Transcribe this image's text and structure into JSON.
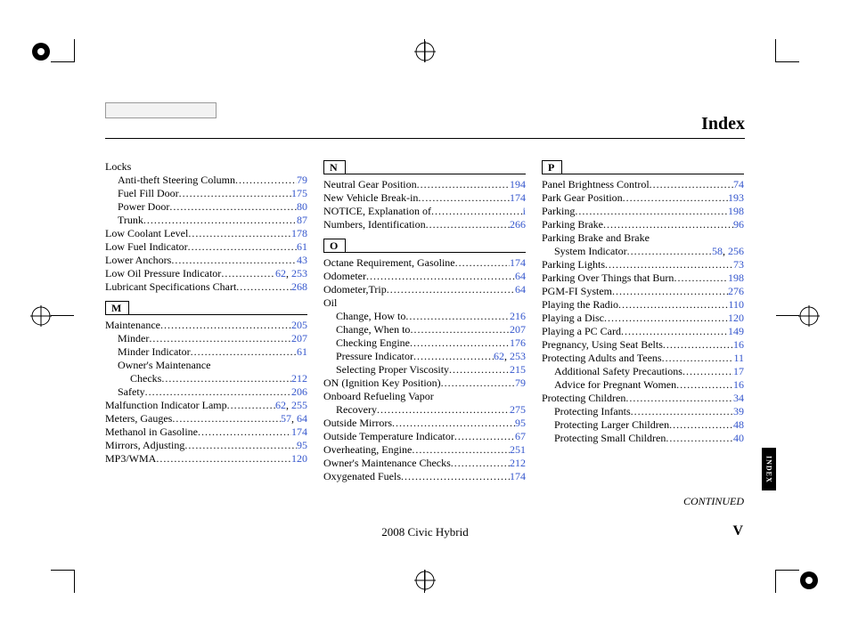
{
  "header": {
    "title": "Index"
  },
  "side_tab": "INDEX",
  "continued_text": "CONTINUED",
  "footer": {
    "model": "2008  Civic  Hybrid",
    "page": "V"
  },
  "sections": {
    "L_pre": [
      {
        "label": "Locks",
        "pages": [],
        "indent": 0,
        "nopage": true
      },
      {
        "label": "Anti-theft Steering Column",
        "pages": [
          "79"
        ],
        "indent": 1
      },
      {
        "label": "Fuel Fill Door",
        "pages": [
          "175"
        ],
        "indent": 1
      },
      {
        "label": "Power Door",
        "pages": [
          "80"
        ],
        "indent": 1
      },
      {
        "label": "Trunk",
        "pages": [
          "87"
        ],
        "indent": 1
      },
      {
        "label": "Low Coolant Level",
        "pages": [
          "178"
        ],
        "indent": 0
      },
      {
        "label": "Low Fuel Indicator",
        "pages": [
          "61"
        ],
        "indent": 0
      },
      {
        "label": "Lower Anchors",
        "pages": [
          "43"
        ],
        "indent": 0
      },
      {
        "label": "Low Oil Pressure Indicator",
        "pages": [
          "62",
          "253"
        ],
        "indent": 0
      },
      {
        "label": "Lubricant Specifications Chart",
        "pages": [
          "268"
        ],
        "indent": 0
      }
    ],
    "M": [
      {
        "label": "Maintenance",
        "pages": [
          "205"
        ],
        "indent": 0
      },
      {
        "label": "Minder",
        "pages": [
          "207"
        ],
        "indent": 1
      },
      {
        "label": "Minder Indicator",
        "pages": [
          "61"
        ],
        "indent": 1
      },
      {
        "label": "Owner's Maintenance",
        "pages": [],
        "indent": 1,
        "nopage": true
      },
      {
        "label": "Checks",
        "pages": [
          "212"
        ],
        "indent": 2
      },
      {
        "label": "Safety",
        "pages": [
          "206"
        ],
        "indent": 1
      },
      {
        "label": "Malfunction Indicator Lamp",
        "pages": [
          "62",
          "255"
        ],
        "indent": 0
      },
      {
        "label": "Meters, Gauges",
        "pages": [
          "57",
          "64"
        ],
        "indent": 0
      },
      {
        "label": "Methanol in Gasoline",
        "pages": [
          "174"
        ],
        "indent": 0
      },
      {
        "label": "Mirrors, Adjusting",
        "pages": [
          "95"
        ],
        "indent": 0
      },
      {
        "label": "MP3/WMA",
        "pages": [
          "120"
        ],
        "indent": 0
      }
    ],
    "N": [
      {
        "label": "Neutral Gear Position",
        "pages": [
          "194"
        ],
        "indent": 0
      },
      {
        "label": "New Vehicle Break-in",
        "pages": [
          "174"
        ],
        "indent": 0
      },
      {
        "label": "NOTICE, Explanation of",
        "pages": [
          "i"
        ],
        "indent": 0
      },
      {
        "label": "Numbers, Identification",
        "pages": [
          "266"
        ],
        "indent": 0
      }
    ],
    "O": [
      {
        "label": "Octane Requirement, Gasoline",
        "pages": [
          "174"
        ],
        "indent": 0
      },
      {
        "label": "Odometer",
        "pages": [
          "64"
        ],
        "indent": 0
      },
      {
        "label": "Odometer,Trip",
        "pages": [
          "64"
        ],
        "indent": 0
      },
      {
        "label": "Oil",
        "pages": [],
        "indent": 0,
        "nopage": true
      },
      {
        "label": "Change, How to",
        "pages": [
          "216"
        ],
        "indent": 1
      },
      {
        "label": "Change, When to",
        "pages": [
          "207"
        ],
        "indent": 1
      },
      {
        "label": "Checking Engine",
        "pages": [
          "176"
        ],
        "indent": 1
      },
      {
        "label": "Pressure Indicator",
        "pages": [
          "62",
          "253"
        ],
        "indent": 1
      },
      {
        "label": "Selecting Proper Viscosity",
        "pages": [
          "215"
        ],
        "indent": 1
      },
      {
        "label": "ON (Ignition Key Position)",
        "pages": [
          "79"
        ],
        "indent": 0
      },
      {
        "label": "Onboard Refueling Vapor",
        "pages": [],
        "indent": 0,
        "nopage": true
      },
      {
        "label": "Recovery",
        "pages": [
          "275"
        ],
        "indent": 1
      },
      {
        "label": "Outside Mirrors",
        "pages": [
          "95"
        ],
        "indent": 0
      },
      {
        "label": "Outside Temperature Indicator",
        "pages": [
          "67"
        ],
        "indent": 0
      },
      {
        "label": "Overheating, Engine",
        "pages": [
          "251"
        ],
        "indent": 0
      },
      {
        "label": "Owner's Maintenance Checks",
        "pages": [
          "212"
        ],
        "indent": 0
      },
      {
        "label": "Oxygenated Fuels",
        "pages": [
          "174"
        ],
        "indent": 0
      }
    ],
    "P": [
      {
        "label": "Panel Brightness Control",
        "pages": [
          "74"
        ],
        "indent": 0
      },
      {
        "label": "Park Gear Position",
        "pages": [
          "193"
        ],
        "indent": 0
      },
      {
        "label": "Parking",
        "pages": [
          "198"
        ],
        "indent": 0
      },
      {
        "label": "Parking Brake",
        "pages": [
          "96"
        ],
        "indent": 0
      },
      {
        "label": "Parking Brake and Brake",
        "pages": [],
        "indent": 0,
        "nopage": true
      },
      {
        "label": "System Indicator",
        "pages": [
          "58",
          "256"
        ],
        "indent": 1
      },
      {
        "label": "Parking Lights",
        "pages": [
          "73"
        ],
        "indent": 0
      },
      {
        "label": "Parking Over Things that Burn",
        "pages": [
          "198"
        ],
        "indent": 0
      },
      {
        "label": "PGM-FI System",
        "pages": [
          "276"
        ],
        "indent": 0
      },
      {
        "label": "Playing the Radio",
        "pages": [
          "110"
        ],
        "indent": 0
      },
      {
        "label": "Playing a Disc",
        "pages": [
          "120"
        ],
        "indent": 0
      },
      {
        "label": "Playing a PC Card",
        "pages": [
          "149"
        ],
        "indent": 0
      },
      {
        "label": "Pregnancy, Using Seat Belts",
        "pages": [
          "16"
        ],
        "indent": 0
      },
      {
        "label": "Protecting Adults and Teens",
        "pages": [
          "11"
        ],
        "indent": 0
      },
      {
        "label": "Additional Safety Precautions",
        "pages": [
          "17"
        ],
        "indent": 1
      },
      {
        "label": "Advice for Pregnant Women",
        "pages": [
          "16"
        ],
        "indent": 1
      },
      {
        "label": "Protecting Children",
        "pages": [
          "34"
        ],
        "indent": 0
      },
      {
        "label": "Protecting Infants",
        "pages": [
          "39"
        ],
        "indent": 1
      },
      {
        "label": "Protecting Larger Children",
        "pages": [
          "48"
        ],
        "indent": 1
      },
      {
        "label": "Protecting Small Children",
        "pages": [
          "40"
        ],
        "indent": 1
      }
    ]
  },
  "letters": {
    "M": "M",
    "N": "N",
    "O": "O",
    "P": "P"
  }
}
